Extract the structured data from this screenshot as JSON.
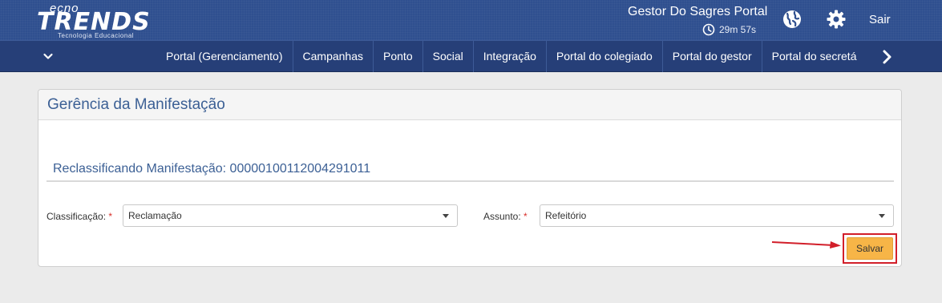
{
  "header": {
    "logo_top": "ecno",
    "logo_main": "TRENDS",
    "logo_sub": "Tecnologia Educacional",
    "portal_title": "Gestor Do Sagres Portal",
    "timer": "29m 57s",
    "logout_label": "Sair"
  },
  "nav": {
    "items": [
      "Portal (Gerenciamento)",
      "Campanhas",
      "Ponto",
      "Social",
      "Integração",
      "Portal do colegiado",
      "Portal do gestor",
      "Portal do secretá"
    ]
  },
  "panel": {
    "title": "Gerência da Manifestação",
    "subheading": "Reclassificando Manifestação: 00000100112004291011"
  },
  "form": {
    "classificacao_label": "Classificação:",
    "classificacao_value": "Reclamação",
    "assunto_label": "Assunto:",
    "assunto_value": "Refeitório",
    "required_mark": "*",
    "save_label": "Salvar"
  },
  "colors": {
    "header_bg": "#2f4f8f",
    "nav_bg": "#263f78",
    "title_blue": "#3c6095",
    "save_button": "#f7b547",
    "highlight_red": "#d21f2a"
  },
  "icons": [
    "clock-icon",
    "globe-icon",
    "gear-icon",
    "chevron-down-icon",
    "chevron-right-icon"
  ]
}
